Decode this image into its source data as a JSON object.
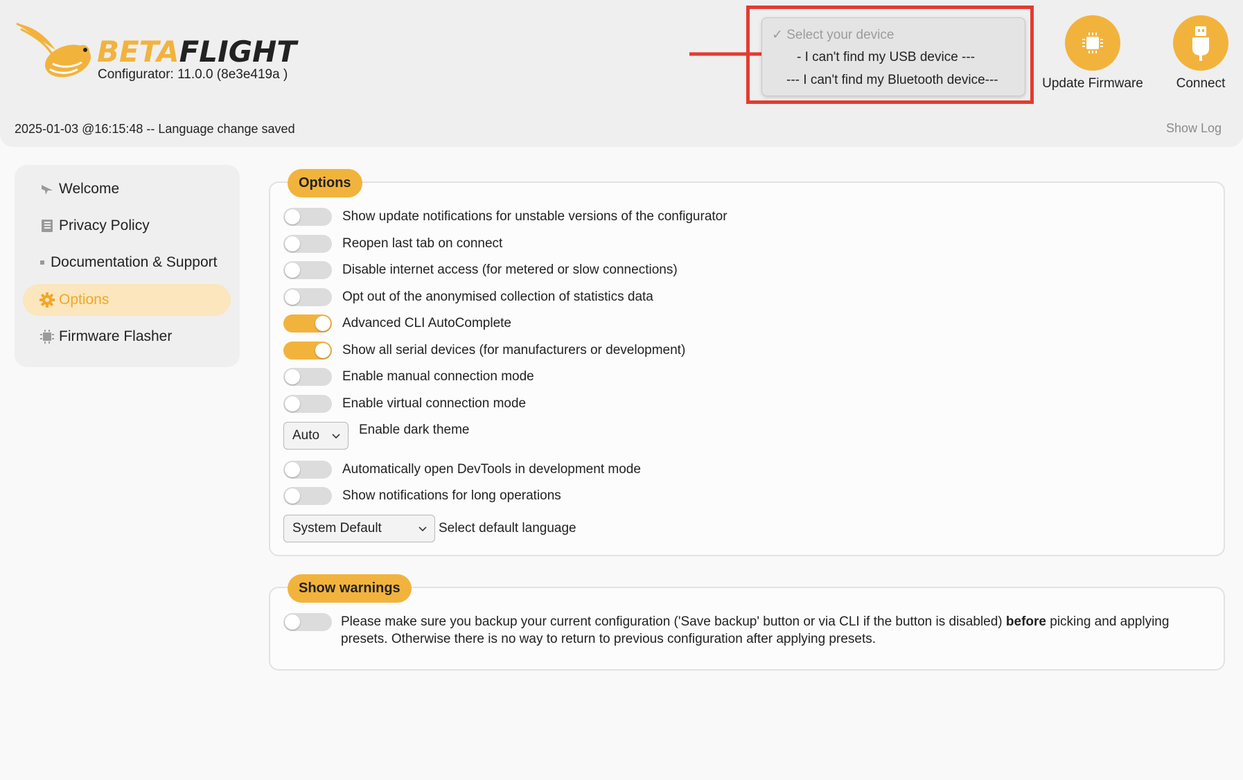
{
  "app": {
    "logo_part1": "BETA",
    "logo_part2": "FLIGHT",
    "configurator_version": "Configurator: 11.0.0 (8e3e419a )"
  },
  "device_select": {
    "placeholder": "Select your device",
    "options": [
      "--- I can't find my USB device ---",
      "--- I can't find my Bluetooth device---"
    ],
    "usb_visible": "- I can't find my USB device ---",
    "bluetooth_visible": "--- I can't find my Bluetooth device---"
  },
  "header_buttons": {
    "update_firmware": "Update Firmware",
    "connect": "Connect"
  },
  "status": {
    "message": "2025-01-03 @16:15:48 -- Language change saved",
    "show_log": "Show Log"
  },
  "sidebar": {
    "items": [
      {
        "label": "Welcome",
        "icon": "plane-icon"
      },
      {
        "label": "Privacy Policy",
        "icon": "book-icon"
      },
      {
        "label": "Documentation & Support",
        "icon": "bullet-icon"
      },
      {
        "label": "Options",
        "icon": "gear-icon",
        "active": true
      },
      {
        "label": "Firmware Flasher",
        "icon": "chip-icon"
      }
    ]
  },
  "options": {
    "title": "Options",
    "toggles": [
      {
        "label": "Show update notifications for unstable versions of the configurator",
        "on": false
      },
      {
        "label": "Reopen last tab on connect",
        "on": false
      },
      {
        "label": "Disable internet access (for metered or slow connections)",
        "on": false
      },
      {
        "label": "Opt out of the anonymised collection of statistics data",
        "on": false
      },
      {
        "label": "Advanced CLI AutoComplete",
        "on": true
      },
      {
        "label": "Show all serial devices (for manufacturers or development)",
        "on": true
      },
      {
        "label": "Enable manual connection mode",
        "on": false
      },
      {
        "label": "Enable virtual connection mode",
        "on": false
      }
    ],
    "dark_theme": {
      "value": "Auto",
      "label": "Enable dark theme"
    },
    "toggles2": [
      {
        "label": "Automatically open DevTools in development mode",
        "on": false
      },
      {
        "label": "Show notifications for long operations",
        "on": false
      }
    ],
    "language": {
      "value": "System Default",
      "label": "Select default language"
    }
  },
  "warnings": {
    "title": "Show warnings",
    "toggle_on": false,
    "text_before": "Please make sure you backup your current configuration ('Save backup' button or via CLI if the button is disabled) ",
    "text_bold": "before",
    "text_after": " picking and applying presets. Otherwise there is no way to return to previous configuration after applying presets."
  },
  "colors": {
    "accent": "#f2b33d",
    "highlight_border": "#e33b30",
    "active_nav_bg": "#fbe6bd"
  }
}
